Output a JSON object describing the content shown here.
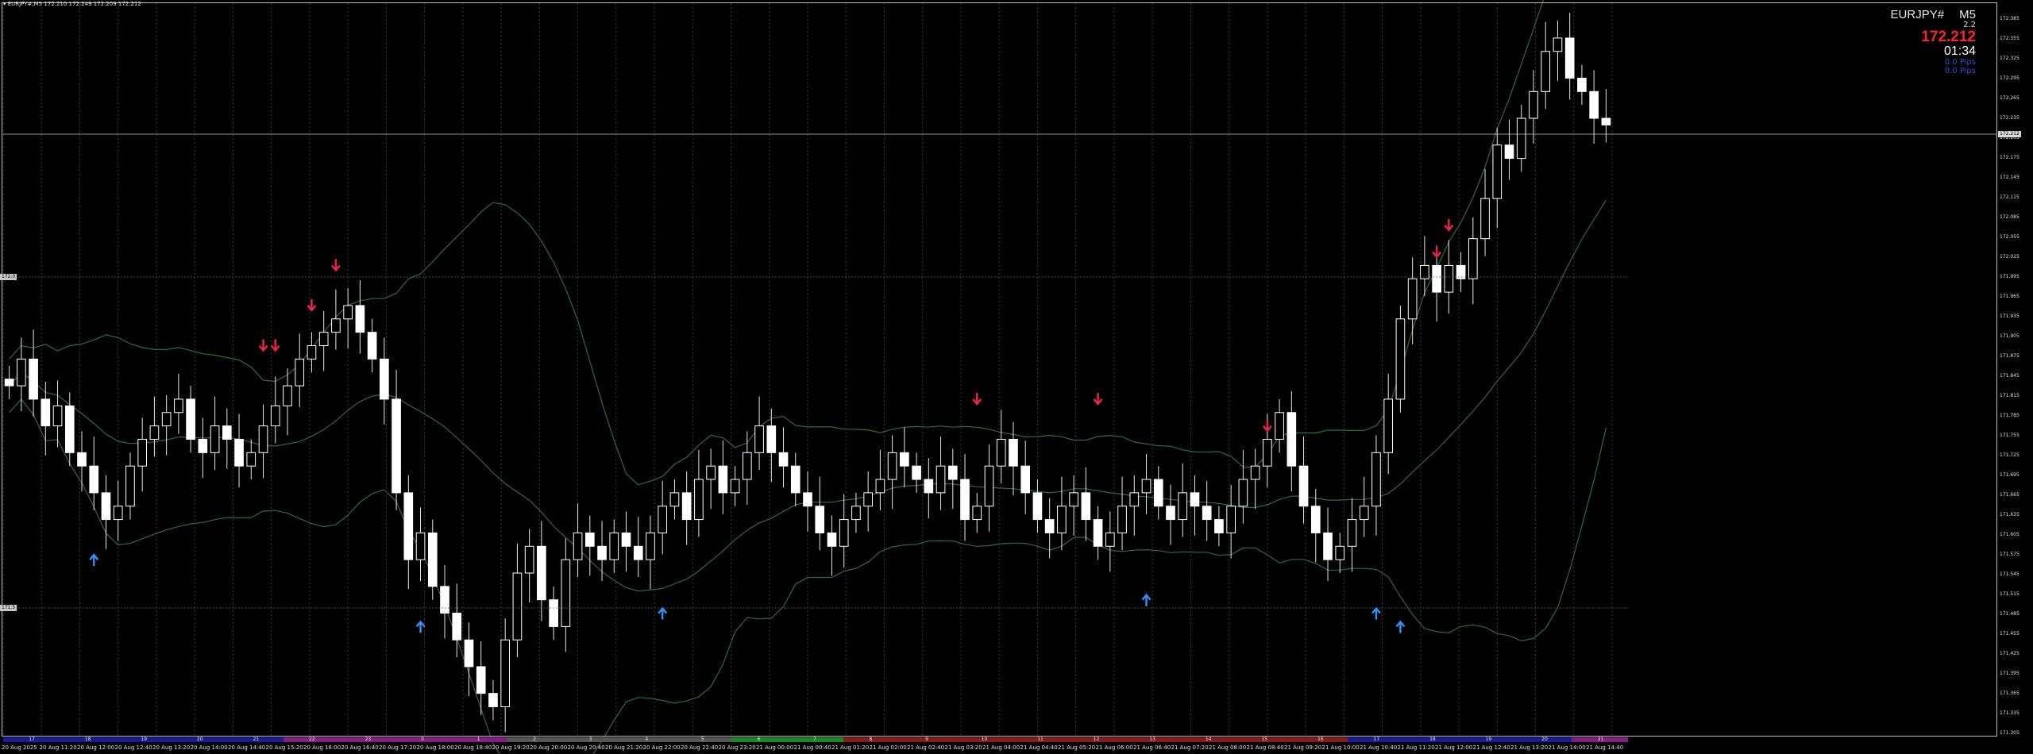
{
  "header": {
    "text": "▾ EURJPY#,M5  172.210 172.249 172.209 172.212"
  },
  "info_panel": {
    "symbol": "EURJPY#",
    "timeframe": "M5",
    "spread": "2.2",
    "price": "172.212",
    "timer": "01:34",
    "pips1": "0.0 Pips",
    "pips2": "0.0 Pips"
  },
  "price_tags": {
    "current": "172.212",
    "level_high": "172.0",
    "level_low": "171.5"
  },
  "y_axis_ticks": [
    "172.385",
    "172.355",
    "172.325",
    "172.295",
    "172.265",
    "172.235",
    "172.205",
    "172.175",
    "172.145",
    "172.115",
    "172.085",
    "172.055",
    "172.025",
    "171.995",
    "171.965",
    "171.935",
    "171.905",
    "171.875",
    "171.845",
    "171.815",
    "171.785",
    "171.755",
    "171.725",
    "171.695",
    "171.665",
    "171.635",
    "171.605",
    "171.575",
    "171.545",
    "171.515",
    "171.485",
    "171.455",
    "171.425",
    "171.395",
    "171.365",
    "171.335",
    "171.305"
  ],
  "x_axis_ticks": [
    "20 Aug 2025",
    "20 Aug 11:20",
    "20 Aug 12:00",
    "20 Aug 12:40",
    "20 Aug 13:20",
    "20 Aug 14:00",
    "20 Aug 14:40",
    "20 Aug 15:20",
    "20 Aug 16:00",
    "20 Aug 16:40",
    "20 Aug 17:20",
    "20 Aug 18:00",
    "20 Aug 18:40",
    "20 Aug 19:20",
    "20 Aug 20:00",
    "20 Aug 20:40",
    "20 Aug 21:20",
    "20 Aug 22:00",
    "20 Aug 22:40",
    "20 Aug 23:20",
    "21 Aug 00:00",
    "21 Aug 00:40",
    "21 Aug 01:20",
    "21 Aug 02:00",
    "21 Aug 02:40",
    "21 Aug 03:20",
    "21 Aug 04:00",
    "21 Aug 04:40",
    "21 Aug 05:20",
    "21 Aug 06:00",
    "21 Aug 06:40",
    "21 Aug 07:20",
    "21 Aug 08:00",
    "21 Aug 08:40",
    "21 Aug 09:20",
    "21 Aug 10:00",
    "21 Aug 10:40",
    "21 Aug 11:20",
    "21 Aug 12:00",
    "21 Aug 12:40",
    "21 Aug 13:20",
    "21 Aug 14:00",
    "21 Aug 14:40"
  ],
  "sessions": [
    {
      "label": "17",
      "color": "#1a1aa0"
    },
    {
      "label": "18",
      "color": "#1a1aa0"
    },
    {
      "label": "19",
      "color": "#1a1aa0"
    },
    {
      "label": "20",
      "color": "#1a1aa0"
    },
    {
      "label": "21",
      "color": "#1a1aa0"
    },
    {
      "label": "22",
      "color": "#8a1a8a"
    },
    {
      "label": "23",
      "color": "#8a1a8a"
    },
    {
      "label": "0",
      "color": "#8a1a8a"
    },
    {
      "label": "1",
      "color": "#8a1a8a"
    },
    {
      "label": "2",
      "color": "#555555"
    },
    {
      "label": "3",
      "color": "#555555"
    },
    {
      "label": "4",
      "color": "#555555"
    },
    {
      "label": "5",
      "color": "#555555"
    },
    {
      "label": "6",
      "color": "#1a8a1a"
    },
    {
      "label": "7",
      "color": "#1a8a1a"
    },
    {
      "label": "8",
      "color": "#8a1a1a"
    },
    {
      "label": "9",
      "color": "#8a1a1a"
    },
    {
      "label": "10",
      "color": "#8a1a1a"
    },
    {
      "label": "11",
      "color": "#8a1a1a"
    },
    {
      "label": "12",
      "color": "#8a1a1a"
    },
    {
      "label": "13",
      "color": "#8a1a1a"
    },
    {
      "label": "14",
      "color": "#8a1a1a"
    },
    {
      "label": "15",
      "color": "#8a1a1a"
    },
    {
      "label": "16",
      "color": "#8a1a1a"
    },
    {
      "label": "17",
      "color": "#1a1aa0"
    },
    {
      "label": "18",
      "color": "#1a1aa0"
    },
    {
      "label": "19",
      "color": "#1a1aa0"
    },
    {
      "label": "20",
      "color": "#1a1aa0"
    },
    {
      "label": "21",
      "color": "#8a1a8a"
    }
  ],
  "chart_data": {
    "type": "candlestick",
    "symbol": "EURJPY#",
    "timeframe": "M5",
    "ylim": [
      171.305,
      172.385
    ],
    "closes": [
      171.82,
      171.86,
      171.8,
      171.76,
      171.79,
      171.72,
      171.7,
      171.66,
      171.62,
      171.64,
      171.7,
      171.74,
      171.76,
      171.78,
      171.8,
      171.74,
      171.72,
      171.76,
      171.74,
      171.7,
      171.72,
      171.76,
      171.79,
      171.82,
      171.86,
      171.88,
      171.9,
      171.92,
      171.94,
      171.9,
      171.86,
      171.8,
      171.66,
      171.56,
      171.6,
      171.52,
      171.48,
      171.44,
      171.4,
      171.36,
      171.34,
      171.44,
      171.54,
      171.58,
      171.5,
      171.46,
      171.56,
      171.6,
      171.58,
      171.56,
      171.6,
      171.58,
      171.56,
      171.6,
      171.64,
      171.66,
      171.62,
      171.68,
      171.7,
      171.66,
      171.68,
      171.72,
      171.76,
      171.72,
      171.7,
      171.66,
      171.64,
      171.6,
      171.58,
      171.62,
      171.64,
      171.66,
      171.68,
      171.72,
      171.7,
      171.68,
      171.66,
      171.7,
      171.68,
      171.62,
      171.64,
      171.7,
      171.74,
      171.7,
      171.66,
      171.62,
      171.6,
      171.64,
      171.66,
      171.62,
      171.58,
      171.6,
      171.64,
      171.66,
      171.68,
      171.64,
      171.62,
      171.66,
      171.64,
      171.62,
      171.6,
      171.64,
      171.68,
      171.7,
      171.74,
      171.78,
      171.7,
      171.64,
      171.6,
      171.56,
      171.58,
      171.62,
      171.64,
      171.72,
      171.8,
      171.92,
      171.98,
      172.0,
      171.96,
      172.0,
      171.98,
      172.04,
      172.1,
      172.18,
      172.16,
      172.22,
      172.26,
      172.32,
      172.34,
      172.28,
      172.26,
      172.22,
      172.21
    ],
    "arrows_down": [
      {
        "i": 21,
        "price": 171.82
      },
      {
        "i": 22,
        "price": 171.82
      },
      {
        "i": 25,
        "price": 171.88
      },
      {
        "i": 27,
        "price": 171.94
      },
      {
        "i": 80,
        "price": 171.74
      },
      {
        "i": 90,
        "price": 171.74
      },
      {
        "i": 104,
        "price": 171.7
      },
      {
        "i": 118,
        "price": 171.96
      },
      {
        "i": 119,
        "price": 172.0
      }
    ],
    "arrows_up": [
      {
        "i": 7,
        "price": 171.62
      },
      {
        "i": 34,
        "price": 171.52
      },
      {
        "i": 54,
        "price": 171.54
      },
      {
        "i": 94,
        "price": 171.56
      },
      {
        "i": 113,
        "price": 171.54
      },
      {
        "i": 115,
        "price": 171.52
      }
    ],
    "hline_current": 172.212,
    "hline_levels": [
      172.0,
      171.5
    ]
  }
}
